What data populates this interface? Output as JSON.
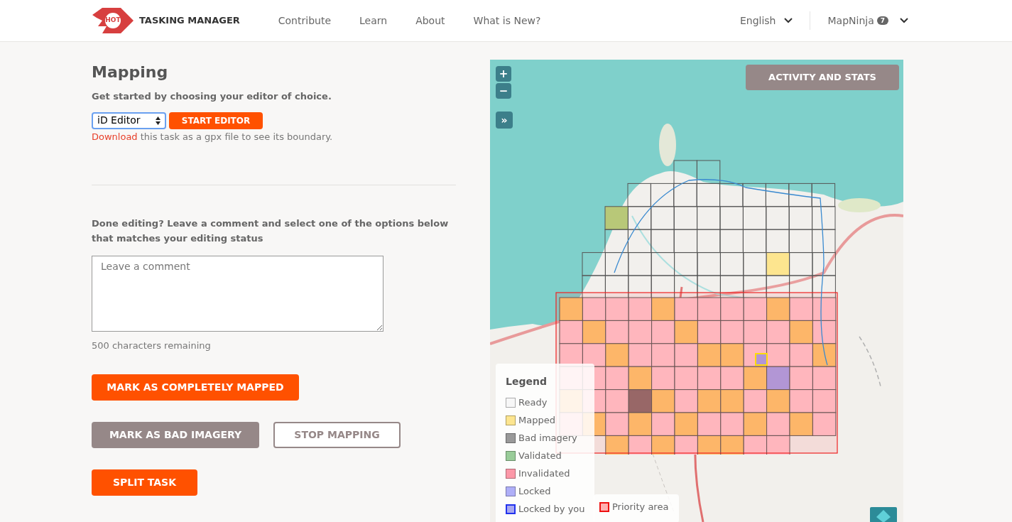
{
  "header": {
    "logo_text": "HOT",
    "brand": "TASKING MANAGER",
    "nav": [
      "Contribute",
      "Learn",
      "About",
      "What is New?"
    ],
    "language": "English",
    "user": {
      "name": "MapNinja",
      "badge": "7"
    }
  },
  "mapping": {
    "title": "Mapping",
    "instruction": "Get started by choosing your editor of choice.",
    "editor_select": {
      "value": "iD Editor"
    },
    "start_button": "START EDITOR",
    "download": {
      "link": "Download",
      "text": " this task as a gpx file to see its boundary."
    },
    "done_prompt": "Done editing? Leave a comment and select one of the options below that matches your editing status",
    "comment": {
      "placeholder": "Leave a comment"
    },
    "chars_remaining": "500 characters remaining",
    "actions": [
      {
        "label": "MARK AS COMPLETELY MAPPED",
        "kind": "primary"
      },
      {
        "label": "MARK AS BAD IMAGERY",
        "kind": "secondary"
      },
      {
        "label": "STOP MAPPING",
        "kind": "outline"
      },
      {
        "label": "SPLIT TASK",
        "kind": "primary"
      }
    ]
  },
  "map": {
    "zoom_in": "+",
    "zoom_out": "−",
    "expand": "»",
    "stats_button": "ACTIVITY AND STATS",
    "legend": {
      "title": "Legend",
      "items": [
        {
          "label": "Ready",
          "color": "#f7f7f7",
          "kind": "swatch"
        },
        {
          "label": "Mapped",
          "color": "#fde58f",
          "kind": "swatch"
        },
        {
          "label": "Bad imagery",
          "color": "#999999",
          "kind": "swatch"
        },
        {
          "label": "Validated",
          "color": "#99cc99",
          "kind": "swatch"
        },
        {
          "label": "Invalidated",
          "color": "#fc98a8",
          "kind": "swatch"
        },
        {
          "label": "Locked",
          "color": "#afaff8",
          "kind": "swatch"
        },
        {
          "label": "Locked by you",
          "color": "#a8a8f0",
          "kind": "own"
        },
        {
          "label": "Priority area",
          "color": "#ffb0b0",
          "kind": "priority"
        }
      ]
    }
  }
}
